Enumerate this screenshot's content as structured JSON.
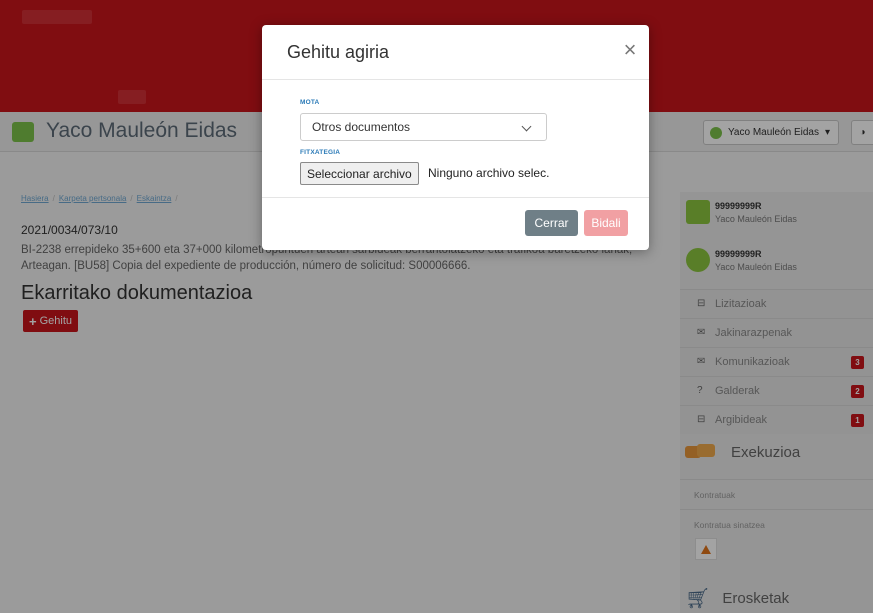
{
  "header": {
    "user_title": "Yaco Mauleón Eidas",
    "user_select": "Yaco Mauleón Eidas",
    "lang_icon": "globe-icon"
  },
  "breadcrumb": [
    "Hasiera",
    "Karpeta pertsonala",
    "Eskaintza"
  ],
  "expedient": {
    "number": "2021/0034/073/10",
    "description": "BI-2238 errepideko 35+600 eta 37+000 kilometropuntuen artean sarbideak berrantolatzeko eta trafikoa baretzeko lanak, Arteagan. [BU58] Copia del expediente de producción, número de solicitud: S00006666."
  },
  "section": {
    "title": "Ekarritako dokumentazioa",
    "add_label": "Gehitu"
  },
  "sidebar": {
    "cards": [
      {
        "id": "99999999R",
        "name": "Yaco Mauleón Eidas"
      },
      {
        "id": "99999999R",
        "name": "Yaco Mauleón Eidas"
      }
    ],
    "menu": [
      {
        "label": "Lizitazioak",
        "icon": "inbox-icon",
        "badge": ""
      },
      {
        "label": "Jakinarazpenak",
        "icon": "envelope-icon",
        "badge": ""
      },
      {
        "label": "Komunikazioak",
        "icon": "envelope-icon",
        "badge": "3"
      },
      {
        "label": "Galderak",
        "icon": "question-icon",
        "badge": "2"
      },
      {
        "label": "Argibideak",
        "icon": "inbox-icon",
        "badge": "1"
      }
    ],
    "execution": {
      "title": "Exekuzioa",
      "items": [
        "Kontratuak",
        "Kontratua sinatzea"
      ]
    },
    "shopping": {
      "title": "Erosketak"
    }
  },
  "modal": {
    "title": "Gehitu agiria",
    "mota_label": "MOTA",
    "mota_value": "Otros documentos",
    "file_label": "FITXATEGIA",
    "file_button": "Seleccionar archivo",
    "file_status": "Ninguno archivo selec.",
    "close_label": "Cerrar",
    "send_label": "Bidali"
  },
  "colors": {
    "brand_red": "#c8151c",
    "link_blue": "#2a7ab7",
    "cancel_gray": "#6f7f87",
    "send_pink": "#f1a0a3"
  }
}
